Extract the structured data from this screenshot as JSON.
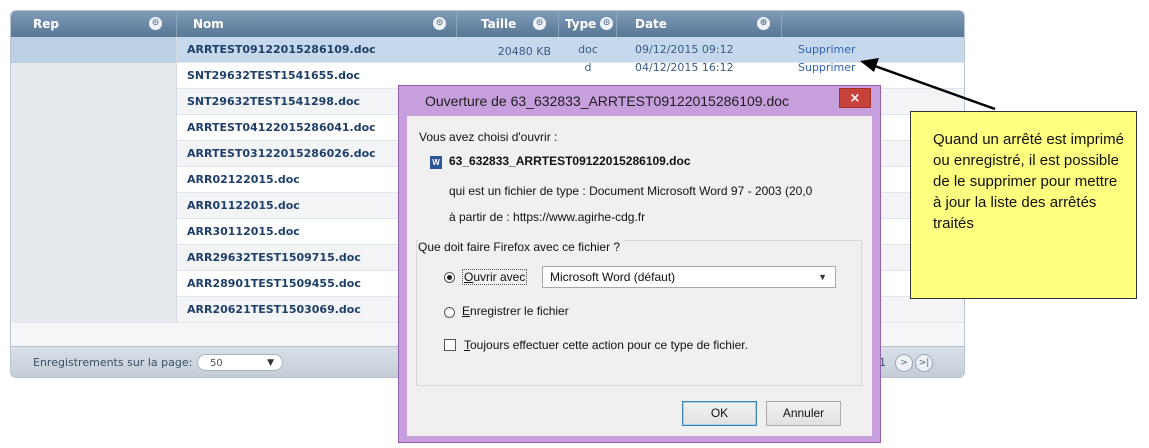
{
  "grid": {
    "headers": {
      "rep": "Rep",
      "nom": "Nom",
      "taille": "Taille",
      "type": "Type",
      "date": "Date"
    },
    "rows": [
      {
        "name": "ARRTEST09122015286109.doc",
        "size": "20480 KB",
        "type": "doc",
        "date": "09/12/2015 09:12",
        "action": "Supprimer",
        "selected": true
      },
      {
        "name": "SNT29632TEST1541655.doc",
        "size": "",
        "type": "d",
        "date": "04/12/2015 16:12",
        "action": "Supprimer"
      },
      {
        "name": "SNT29632TEST1541298.doc"
      },
      {
        "name": "ARRTEST04122015286041.doc"
      },
      {
        "name": "ARRTEST03122015286026.doc"
      },
      {
        "name": "ARR02122015.doc"
      },
      {
        "name": "ARR01122015.doc"
      },
      {
        "name": "ARR30112015.doc"
      },
      {
        "name": "ARR29632TEST1509715.doc"
      },
      {
        "name": "ARR28901TEST1509455.doc"
      },
      {
        "name": "ARR20621TEST1503069.doc"
      }
    ],
    "footer": {
      "per_page_label": "Enregistrements sur la page:",
      "per_page_value": "50",
      "page_number": "1"
    }
  },
  "dialog": {
    "title": "Ouverture de 63_632833_ARRTEST09122015286109.doc",
    "close_label": "×",
    "chosen_label": "Vous avez choisi d'ouvrir :",
    "filename": "63_632833_ARRTEST09122015286109.doc",
    "file_type_line": "qui est un fichier de type : Document Microsoft Word 97 - 2003 (20,0",
    "from_line": "à partir de : https://www.agirhe-cdg.fr",
    "question": "Que doit faire Firefox avec ce fichier ?",
    "open_with_first": "O",
    "open_with_rest": "uvrir avec",
    "app_select": "Microsoft Word (défaut)",
    "save_first": "E",
    "save_rest": "nregistrer le fichier",
    "always_first": "T",
    "always_rest": "oujours effectuer cette action pour ce type de fichier.",
    "ok_label": "OK",
    "cancel_label": "Annuler",
    "open_with_selected": true
  },
  "callout": {
    "text": "Quand un arrêté est imprimé ou enregistré, il est possible de le supprimer pour mettre à jour la liste des arrêtés traités"
  },
  "colors": {
    "header": "#6a88a6",
    "selected_row": "#c6d9ec",
    "dialog_frame": "#c79fdc",
    "close_button": "#c7423b",
    "callout": "#ffff80"
  }
}
